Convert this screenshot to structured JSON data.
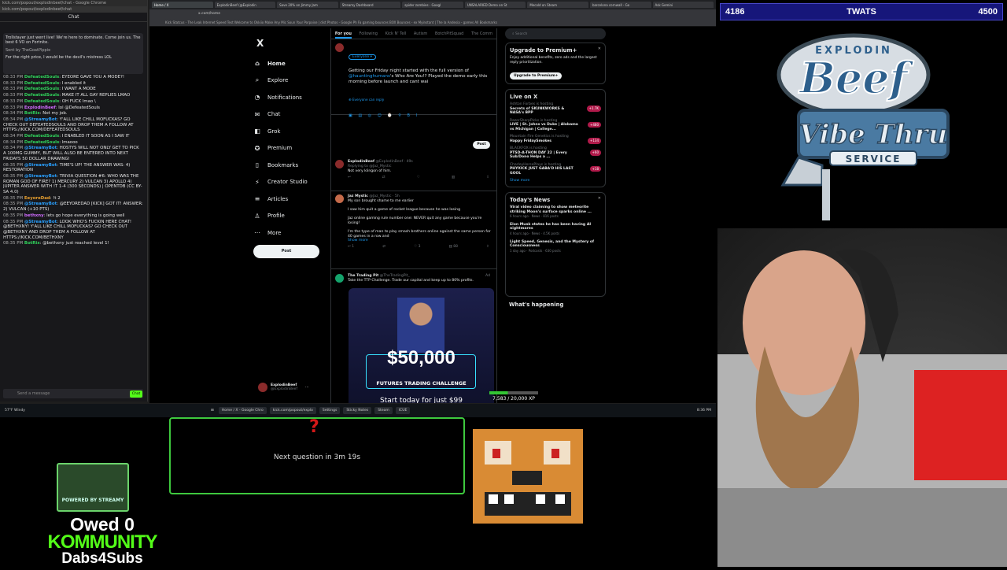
{
  "chrome_left": {
    "window_title": "kick.com/popout/explodinbeef/chat - Google Chrome",
    "url": "kick.com/popout/explodinbeef/chat",
    "chat_title": "Chat",
    "pinned": [
      "Trollstayer just went live! We're here to dominate. Come join us. The best 6 VO on Fortnite.",
      "Sent by TheGoatPlppie",
      "For the right price, I would be the devil's mistress LOL"
    ],
    "messages": [
      {
        "time": "08:33 PM",
        "user": "DefeatedSouls",
        "cls": "u1",
        "text": "EYEORE GAVE YOU A MODE?!"
      },
      {
        "time": "08:33 PM",
        "user": "DefeatedSouls",
        "cls": "u1",
        "text": "I enabled it"
      },
      {
        "time": "08:33 PM",
        "user": "DefeatedSouls",
        "cls": "u1",
        "text": "I WANT A MODE"
      },
      {
        "time": "08:33 PM",
        "user": "DefeatedSouls",
        "cls": "u1",
        "text": "MAKE IT ALL GAY REPLIES LMAO"
      },
      {
        "time": "08:33 PM",
        "user": "DefeatedSouls",
        "cls": "u1",
        "text": "OH FUCK lmao \\"
      },
      {
        "time": "08:33 PM",
        "user": "ExplodinBeef",
        "cls": "u4",
        "text": "lol @DefeatedSouls"
      },
      {
        "time": "08:34 PM",
        "user": "BotRix",
        "cls": "u1",
        "text": "Not my job."
      },
      {
        "time": "08:34 PM",
        "user": "@StreamyBot",
        "cls": "u2",
        "text": "Y'ALL LIKE CHILL MOFUCKAS? GO CHECK OUT DEFEATEDSOULS AND DROP THEM A FOLLOW AT HTTPS://KICK.COM/DEFEATEDSOULS"
      },
      {
        "time": "08:34 PM",
        "user": "DefeatedSouls",
        "cls": "u1",
        "text": "I ENABLED IT SOON AS I SAW IT"
      },
      {
        "time": "08:34 PM",
        "user": "DefeatedSouls",
        "cls": "u1",
        "text": "lmaooo"
      },
      {
        "time": "08:34 PM",
        "user": "@StreamyBot",
        "cls": "u2",
        "text": "HOSTYS WILL NOT ONLY GET TO PICK A 100MG GUMMY, BUT WILL ALSO BE ENTERED INTO NEXT FRIDAYS 50 DOLLAR DRAWING!"
      },
      {
        "time": "08:35 PM",
        "user": "@StreamyBot",
        "cls": "u2",
        "text": "TIME'S UP! THE ANSWER WAS: 4) RESTORATION"
      },
      {
        "time": "08:35 PM",
        "user": "@StreamyBot",
        "cls": "u2",
        "text": "TRIVIA QUESTION #6: WHO WAS THE ROMAN GOD OF FIRE? 1) MERCURY 2) VULCAN 3) APOLLO 4) JUPITER ANSWER WITH !T 1-4 (300 SECONDS) | OPENTDB (CC BY-SA 4.0)"
      },
      {
        "time": "08:35 PM",
        "user": "EeyoreDad",
        "cls": "u3",
        "text": "!t 2"
      },
      {
        "time": "08:35 PM",
        "user": "@StreamyBot",
        "cls": "u2",
        "text": "@EEYOREDAD [KICK] GOT IT! ANSWER: 2) VULCAN (+10 PTS)"
      },
      {
        "time": "08:35 PM",
        "user": "bethxny",
        "cls": "u4",
        "text": "lets go hope everything is going well"
      },
      {
        "time": "08:35 PM",
        "user": "@StreamyBot",
        "cls": "u2",
        "text": "LOOK WHO'S FUCKIN HERE CHAT! @BETHXNY! Y'ALL LIKE CHILL MOFUCKAS? GO CHECK OUT @BETHXNY AND DROP THEM A FOLLOW AT HTTPS://KICK.COM/BETHXNY"
      },
      {
        "time": "08:35 PM",
        "user": "BotRix",
        "cls": "u1",
        "text": "@bethxny just reached level 1!"
      }
    ],
    "input_placeholder": "Send a message",
    "send_label": "Chat"
  },
  "browser": {
    "tabs": [
      "Home / X",
      "ExplodinBeef (@Explodin",
      "Save 20% on Jimmy Jam",
      "Streamy Dashboard",
      "spider zombies - Googl",
      "UNSALARIED Demo on St",
      "Mecold on Steam",
      "barcelona cornwall - Go",
      "Ask Gemini"
    ],
    "url": "x.com/home",
    "bookmarks": "Kick   Statcus - The Leak   Internet Speed Test   Welcome to Okkiio   Make Any Mic Soun   Your Porpoise | dist   Photos - Google Ph   Fa gaming bounces   BOX Bounces - ex   Myinstant | The la   Andesia - games   All Bookmarks"
  },
  "x": {
    "logo": "X",
    "nav": [
      {
        "icon": "⌂",
        "label": "Home",
        "name": "home"
      },
      {
        "icon": "⌕",
        "label": "Explore",
        "name": "explore"
      },
      {
        "icon": "◔",
        "label": "Notifications",
        "name": "notifications"
      },
      {
        "icon": "✉",
        "label": "Chat",
        "name": "chat"
      },
      {
        "icon": "◧",
        "label": "Grok",
        "name": "grok"
      },
      {
        "icon": "✪",
        "label": "Premium",
        "name": "premium"
      },
      {
        "icon": "▯",
        "label": "Bookmarks",
        "name": "bookmarks"
      },
      {
        "icon": "⚡",
        "label": "Creator Studio",
        "name": "creator-studio"
      },
      {
        "icon": "≡",
        "label": "Articles",
        "name": "articles"
      },
      {
        "icon": "♙",
        "label": "Profile",
        "name": "profile"
      },
      {
        "icon": "⋯",
        "label": "More",
        "name": "more"
      }
    ],
    "post_label": "Post",
    "profile_name": "ExplodinBeef",
    "profile_handle": "@ExplodinBeef",
    "timeline_tabs": [
      "For you",
      "Following",
      "Kick N' Tell",
      "Autism",
      "BotchPitSquad",
      "The Comm"
    ],
    "composer": {
      "audience": "Everyone",
      "text_a": "Getting our Friday night started with the full version of ",
      "mention": "@hauntinghumans",
      "text_b": "'s Who Are You!? Played the demo early this morning before launch and cant wai",
      "reply_setting": "Everyone can reply",
      "post_label": "Post"
    },
    "tweets": [
      {
        "name": "ExplodinBeef",
        "handle": "@ExplodinBeef · 49s",
        "sub": "Replying to @Jaz_Mystic",
        "text": "Not very klingon of him.",
        "actions": [
          "↩",
          "⇄",
          "♡",
          "▥",
          "⇪"
        ]
      },
      {
        "name": "Jaz Mystic",
        "handle": "@Jaz_Mystic · 5h",
        "text": "My son brought shame to me earlier\n\nI saw him quit a game of rocket league because he was losing\n\nJaz online gaming rule number one: NEVER quit any game because you're losing!\n\nI'm the type of man to play smash brothers online against the same person for 40 games in a row and",
        "more": "Show more",
        "actions": [
          "↩ 1",
          "⇄",
          "♡ 3",
          "▥ 88",
          "⇪"
        ]
      },
      {
        "name": "The Trading Pit",
        "handle": "@TheTradingPit_",
        "text": "Take the TTP Challenge. Trade our capital and keep up to 80% profits.",
        "ad": "Ad",
        "ad_title": "$50,000",
        "ad_sub": "FUTURES TRADING CHALLENGE",
        "ad_cta": "Start today for just $99"
      }
    ],
    "search_placeholder": "Search",
    "premium": {
      "title": "Upgrade to Premium+",
      "text": "Enjoy additional benefits, zero ads and the largest reply prioritization.",
      "button": "Upgrade to Premium+"
    },
    "live": {
      "title": "Live on X",
      "items": [
        {
          "who": "Ashton Forbes is hosting",
          "title": "Secrets of SKUNKWORKS & NASA's BPP",
          "badge": "+1.7K"
        },
        {
          "who": "RazorSharpPicks is hosting",
          "title": "LIVE | St. Johns vs Duke | Alabama vs Michigan | College...",
          "badge": "+480"
        },
        {
          "who": "Mountain Fire Genetics is hosting",
          "title": "Happy FridaySmokes",
          "badge": "+134"
        },
        {
          "who": "BLACKFOX is hosting",
          "title": "PTSD-A-THON DAY 22 | Every Sub/Dono Helps a ...",
          "badge": "+60"
        },
        {
          "who": "CharleyHorsePlays is hosting",
          "title": "PHYXICK JUST GABA'D HIS LAST GOOL",
          "badge": "+18"
        }
      ],
      "more": "Show more"
    },
    "news": {
      "title": "Today's News",
      "items": [
        {
          "title": "Viral video claiming to show meteorite striking Moon's surface sparks online ...",
          "meta": "6 hours ago · News · 816 posts"
        },
        {
          "title": "Elon Musk states he has been having AI nightmares",
          "meta": "4 hours ago · News · 4.5K posts"
        },
        {
          "title": "Light Speed, Genesis, and the Mystery of Consciousness",
          "meta": "1 day ago · Podcasts · 630 posts"
        }
      ]
    },
    "whats_happening": "What's happening"
  },
  "taskbar": {
    "weather": "57°F Windy",
    "items": [
      "Home / X - Google Chro",
      "kick.com/popout/explo",
      "Settings",
      "Sticky Notes",
      "Steam",
      "ICUE"
    ],
    "clock": "8:36 PM"
  },
  "overlay": {
    "score_left": "4186",
    "score_title": "TWATS",
    "score_right": "4500",
    "logo_top": "EXPLODIN",
    "logo_beef": "Beef",
    "logo_vibe": "Vibe Thru",
    "logo_service": "SERVICE",
    "question_mark": "?",
    "question_text": "Next question in 3m 19s",
    "streamy_label": "POWERED BY STREAMY",
    "xp_text": "7,583 / 20,000 XP",
    "xp_progress": 0.38,
    "owed": "Owed 0",
    "kommunity": "KOMMUNITY",
    "dabs": "Dabs4Subs"
  }
}
